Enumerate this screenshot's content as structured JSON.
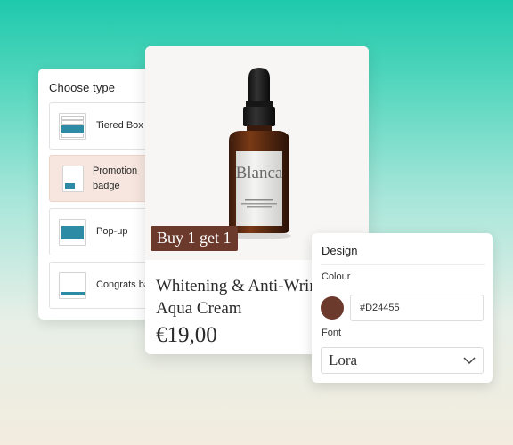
{
  "choose_type": {
    "title": "Choose type",
    "options": [
      {
        "label": "Tiered Box",
        "thumbnail": "tiered-box-icon",
        "selected": false
      },
      {
        "label": "Promotion badge",
        "thumbnail": "promotion-badge-icon",
        "selected": true
      },
      {
        "label": "Pop-up",
        "thumbnail": "pop-up-icon",
        "selected": false
      },
      {
        "label": "Congrats bar",
        "thumbnail": "congrats-bar-icon",
        "selected": false
      }
    ]
  },
  "product": {
    "bottle_brand": "Blanca",
    "badge_text": "Buy 1 get 1",
    "name": "Whitening & Anti-Wrinkle\nAqua Cream",
    "price": "€19,00"
  },
  "design": {
    "title": "Design",
    "colour_label": "Colour",
    "colour_value": "#D24455",
    "swatch_color": "#6b3a2c",
    "font_label": "Font",
    "font_value": "Lora"
  },
  "colors": {
    "accent": "#2d8ba6",
    "badge": "#6b3a2c",
    "selected_bg": "#f6e6df"
  }
}
